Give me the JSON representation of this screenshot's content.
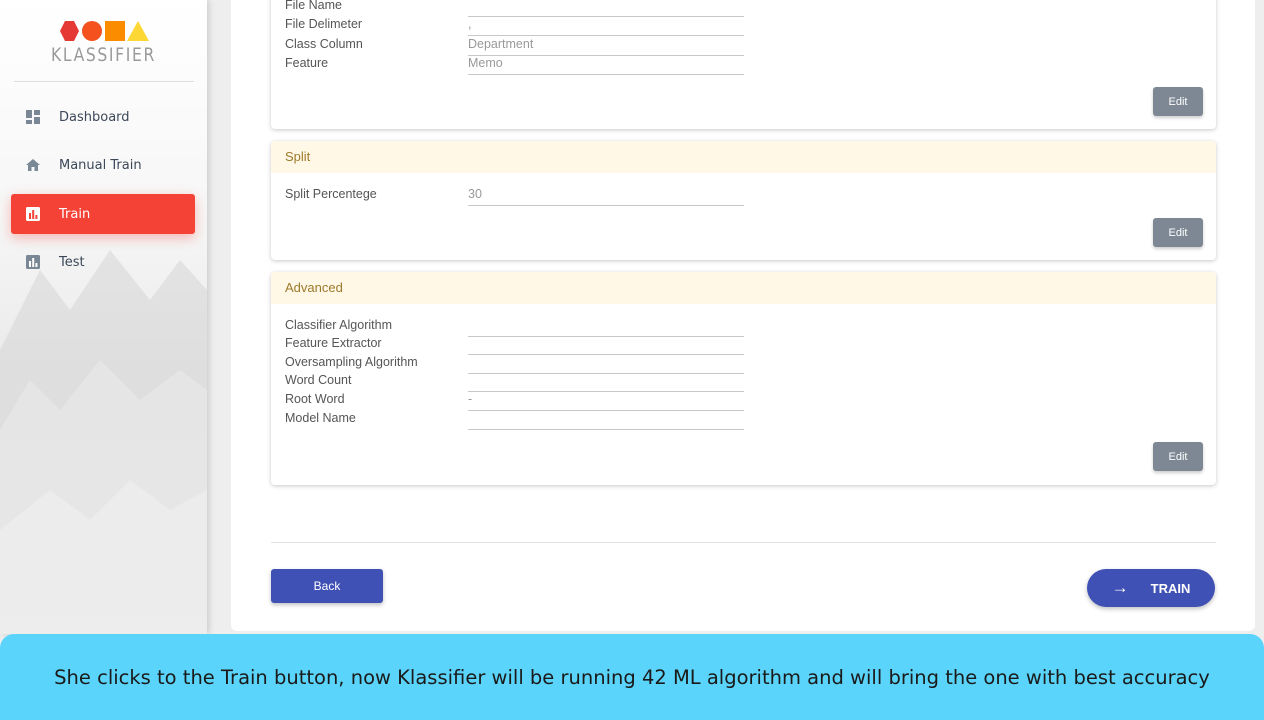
{
  "app": {
    "brand": "KLASSIFIER"
  },
  "sidebar": {
    "items": [
      {
        "label": "Dashboard",
        "icon": "dashboard-icon"
      },
      {
        "label": "Manual Train",
        "icon": "home-icon"
      },
      {
        "label": "Train",
        "icon": "bar-chart-icon",
        "active": true
      },
      {
        "label": "Test",
        "icon": "bar-chart-icon"
      }
    ]
  },
  "cards": {
    "file": {
      "fields": [
        {
          "label": "File Name",
          "value": ""
        },
        {
          "label": "File Delimeter",
          "value": ","
        },
        {
          "label": "Class Column",
          "value": "Department"
        },
        {
          "label": "Feature",
          "value": "Memo"
        }
      ],
      "edit_label": "Edit"
    },
    "split": {
      "title": "Split",
      "fields": [
        {
          "label": "Split Percentege",
          "value": "30"
        }
      ],
      "edit_label": "Edit"
    },
    "advanced": {
      "title": "Advanced",
      "fields": [
        {
          "label": "Classifier Algorithm",
          "value": ""
        },
        {
          "label": "Feature Extractor",
          "value": ""
        },
        {
          "label": "Oversampling Algorithm",
          "value": ""
        },
        {
          "label": "Word Count",
          "value": ""
        },
        {
          "label": "Root Word",
          "value": "-"
        },
        {
          "label": "Model Name",
          "value": ""
        }
      ],
      "edit_label": "Edit"
    }
  },
  "actions": {
    "back_label": "Back",
    "train_label": "TRAIN",
    "train_icon": "arrow-right-icon"
  },
  "caption": {
    "text": "She clicks to the Train button, now Klassifier will be running 42 ML algorithm and will bring the one with best accuracy"
  },
  "colors": {
    "active": "#f44336",
    "primary": "#3f51b5",
    "edit": "#7d8894",
    "header_bg": "#fff8e7",
    "caption_bg": "#5ad4fa"
  }
}
